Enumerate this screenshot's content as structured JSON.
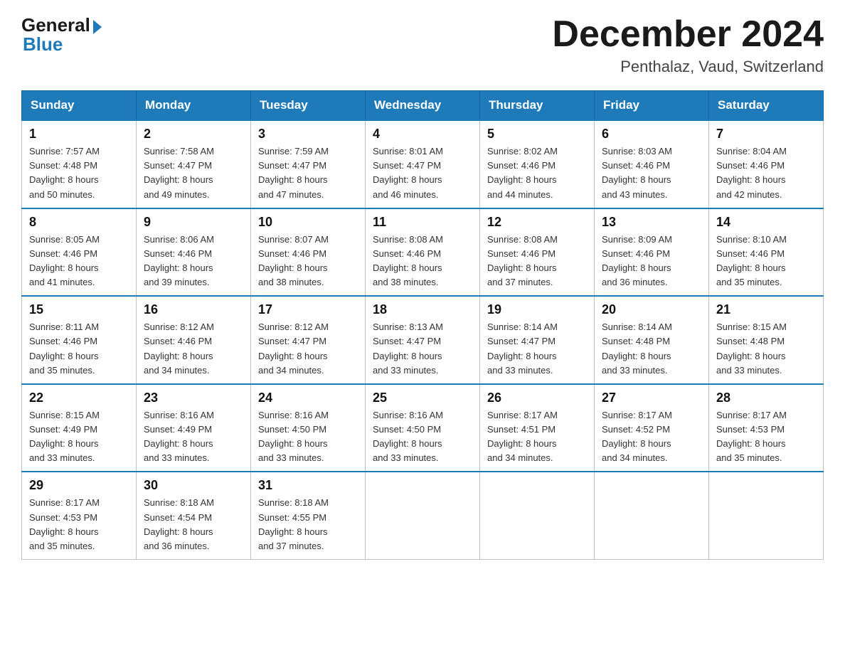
{
  "header": {
    "logo_general": "General",
    "logo_blue": "Blue",
    "month_title": "December 2024",
    "location": "Penthalaz, Vaud, Switzerland"
  },
  "days_of_week": [
    "Sunday",
    "Monday",
    "Tuesday",
    "Wednesday",
    "Thursday",
    "Friday",
    "Saturday"
  ],
  "weeks": [
    [
      {
        "day": "1",
        "sunrise": "7:57 AM",
        "sunset": "4:48 PM",
        "daylight": "8 hours and 50 minutes."
      },
      {
        "day": "2",
        "sunrise": "7:58 AM",
        "sunset": "4:47 PM",
        "daylight": "8 hours and 49 minutes."
      },
      {
        "day": "3",
        "sunrise": "7:59 AM",
        "sunset": "4:47 PM",
        "daylight": "8 hours and 47 minutes."
      },
      {
        "day": "4",
        "sunrise": "8:01 AM",
        "sunset": "4:47 PM",
        "daylight": "8 hours and 46 minutes."
      },
      {
        "day": "5",
        "sunrise": "8:02 AM",
        "sunset": "4:46 PM",
        "daylight": "8 hours and 44 minutes."
      },
      {
        "day": "6",
        "sunrise": "8:03 AM",
        "sunset": "4:46 PM",
        "daylight": "8 hours and 43 minutes."
      },
      {
        "day": "7",
        "sunrise": "8:04 AM",
        "sunset": "4:46 PM",
        "daylight": "8 hours and 42 minutes."
      }
    ],
    [
      {
        "day": "8",
        "sunrise": "8:05 AM",
        "sunset": "4:46 PM",
        "daylight": "8 hours and 41 minutes."
      },
      {
        "day": "9",
        "sunrise": "8:06 AM",
        "sunset": "4:46 PM",
        "daylight": "8 hours and 39 minutes."
      },
      {
        "day": "10",
        "sunrise": "8:07 AM",
        "sunset": "4:46 PM",
        "daylight": "8 hours and 38 minutes."
      },
      {
        "day": "11",
        "sunrise": "8:08 AM",
        "sunset": "4:46 PM",
        "daylight": "8 hours and 38 minutes."
      },
      {
        "day": "12",
        "sunrise": "8:08 AM",
        "sunset": "4:46 PM",
        "daylight": "8 hours and 37 minutes."
      },
      {
        "day": "13",
        "sunrise": "8:09 AM",
        "sunset": "4:46 PM",
        "daylight": "8 hours and 36 minutes."
      },
      {
        "day": "14",
        "sunrise": "8:10 AM",
        "sunset": "4:46 PM",
        "daylight": "8 hours and 35 minutes."
      }
    ],
    [
      {
        "day": "15",
        "sunrise": "8:11 AM",
        "sunset": "4:46 PM",
        "daylight": "8 hours and 35 minutes."
      },
      {
        "day": "16",
        "sunrise": "8:12 AM",
        "sunset": "4:46 PM",
        "daylight": "8 hours and 34 minutes."
      },
      {
        "day": "17",
        "sunrise": "8:12 AM",
        "sunset": "4:47 PM",
        "daylight": "8 hours and 34 minutes."
      },
      {
        "day": "18",
        "sunrise": "8:13 AM",
        "sunset": "4:47 PM",
        "daylight": "8 hours and 33 minutes."
      },
      {
        "day": "19",
        "sunrise": "8:14 AM",
        "sunset": "4:47 PM",
        "daylight": "8 hours and 33 minutes."
      },
      {
        "day": "20",
        "sunrise": "8:14 AM",
        "sunset": "4:48 PM",
        "daylight": "8 hours and 33 minutes."
      },
      {
        "day": "21",
        "sunrise": "8:15 AM",
        "sunset": "4:48 PM",
        "daylight": "8 hours and 33 minutes."
      }
    ],
    [
      {
        "day": "22",
        "sunrise": "8:15 AM",
        "sunset": "4:49 PM",
        "daylight": "8 hours and 33 minutes."
      },
      {
        "day": "23",
        "sunrise": "8:16 AM",
        "sunset": "4:49 PM",
        "daylight": "8 hours and 33 minutes."
      },
      {
        "day": "24",
        "sunrise": "8:16 AM",
        "sunset": "4:50 PM",
        "daylight": "8 hours and 33 minutes."
      },
      {
        "day": "25",
        "sunrise": "8:16 AM",
        "sunset": "4:50 PM",
        "daylight": "8 hours and 33 minutes."
      },
      {
        "day": "26",
        "sunrise": "8:17 AM",
        "sunset": "4:51 PM",
        "daylight": "8 hours and 34 minutes."
      },
      {
        "day": "27",
        "sunrise": "8:17 AM",
        "sunset": "4:52 PM",
        "daylight": "8 hours and 34 minutes."
      },
      {
        "day": "28",
        "sunrise": "8:17 AM",
        "sunset": "4:53 PM",
        "daylight": "8 hours and 35 minutes."
      }
    ],
    [
      {
        "day": "29",
        "sunrise": "8:17 AM",
        "sunset": "4:53 PM",
        "daylight": "8 hours and 35 minutes."
      },
      {
        "day": "30",
        "sunrise": "8:18 AM",
        "sunset": "4:54 PM",
        "daylight": "8 hours and 36 minutes."
      },
      {
        "day": "31",
        "sunrise": "8:18 AM",
        "sunset": "4:55 PM",
        "daylight": "8 hours and 37 minutes."
      },
      null,
      null,
      null,
      null
    ]
  ],
  "labels": {
    "sunrise": "Sunrise:",
    "sunset": "Sunset:",
    "daylight": "Daylight:"
  }
}
